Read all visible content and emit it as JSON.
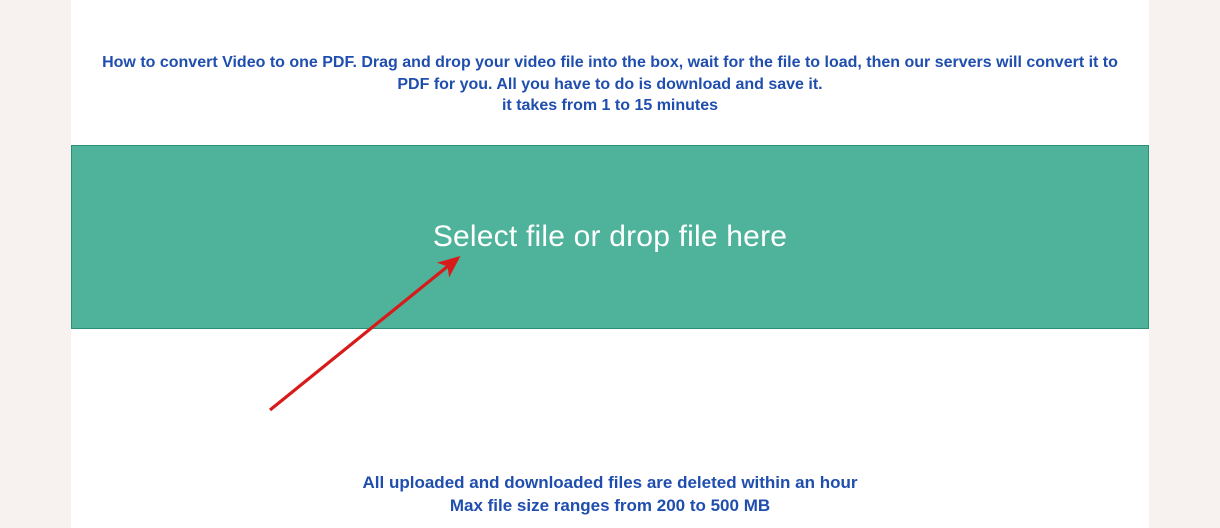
{
  "instructions": {
    "line1": "How to convert Video to one PDF. Drag and drop your video file into the box, wait for the file to load, then our servers will convert it to",
    "line2": "PDF for you. All you have to do is download and save it.",
    "line3": "it takes from 1 to 15 minutes"
  },
  "dropzone": {
    "label": "Select file or drop file here"
  },
  "footer": {
    "line1": "All uploaded and downloaded files are deleted within an hour",
    "line2": "Max file size ranges from 200 to 500 MB"
  },
  "colors": {
    "accent_text": "#1f4eae",
    "dropzone_bg": "#4eb39a",
    "annotation_arrow": "#d71b1b"
  }
}
